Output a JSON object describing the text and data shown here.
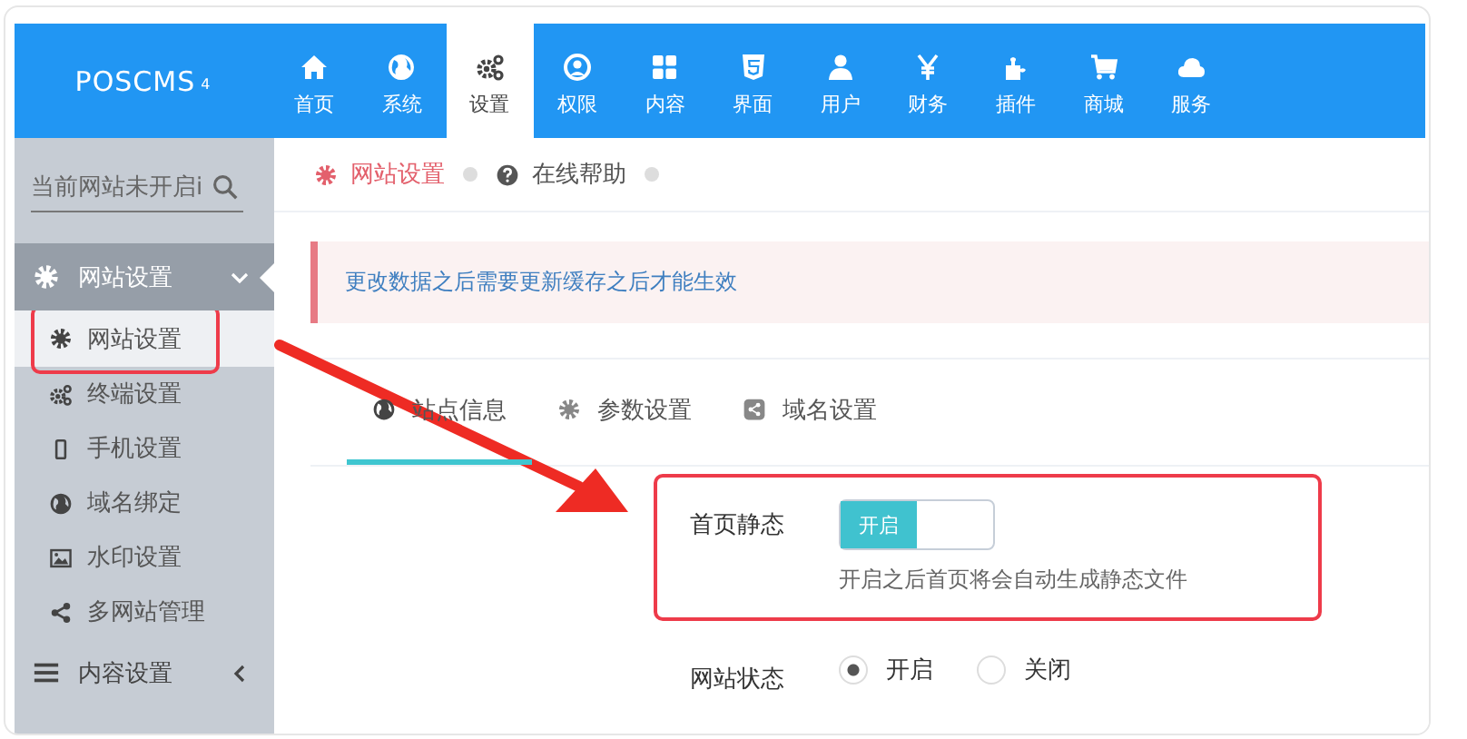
{
  "header": {
    "logo": "POSCMS",
    "logo_version": "4",
    "nav": [
      {
        "label": "首页",
        "selected": false
      },
      {
        "label": "系统",
        "selected": false
      },
      {
        "label": "设置",
        "selected": true
      },
      {
        "label": "权限",
        "selected": false
      },
      {
        "label": "内容",
        "selected": false
      },
      {
        "label": "界面",
        "selected": false
      },
      {
        "label": "用户",
        "selected": false
      },
      {
        "label": "财务",
        "selected": false
      },
      {
        "label": "插件",
        "selected": false
      },
      {
        "label": "商城",
        "selected": false
      },
      {
        "label": "服务",
        "selected": false
      }
    ]
  },
  "sidebar": {
    "search": {
      "value": "当前网站未开启i"
    },
    "groups": [
      {
        "label": "网站设置",
        "expanded": true,
        "children": [
          {
            "label": "网站设置",
            "selected": true,
            "highlighted": true
          },
          {
            "label": "终端设置",
            "selected": false,
            "highlighted": false
          },
          {
            "label": "手机设置",
            "selected": false,
            "highlighted": false
          },
          {
            "label": "域名绑定",
            "selected": false,
            "highlighted": false
          },
          {
            "label": "水印设置",
            "selected": false,
            "highlighted": false
          },
          {
            "label": "多网站管理",
            "selected": false,
            "highlighted": false
          }
        ]
      },
      {
        "label": "内容设置",
        "expanded": false
      }
    ]
  },
  "breadcrumb": [
    {
      "label": "网站设置",
      "selected": true
    },
    {
      "label": "在线帮助",
      "selected": false
    }
  ],
  "alert": "更改数据之后需要更新缓存之后才能生效",
  "tabs": [
    {
      "label": "站点信息",
      "selected": true
    },
    {
      "label": "参数设置",
      "selected": false
    },
    {
      "label": "域名设置",
      "selected": false
    }
  ],
  "form": [
    {
      "kind": "toggle",
      "label": "首页静态",
      "on": true,
      "on_label": "开启",
      "hint": "开启之后首页将会自动生成静态文件",
      "highlighted": true
    },
    {
      "kind": "radio",
      "label": "网站状态",
      "highlighted": false,
      "options": [
        {
          "label": "开启",
          "selected": true
        },
        {
          "label": "关闭",
          "selected": false
        }
      ]
    }
  ]
}
